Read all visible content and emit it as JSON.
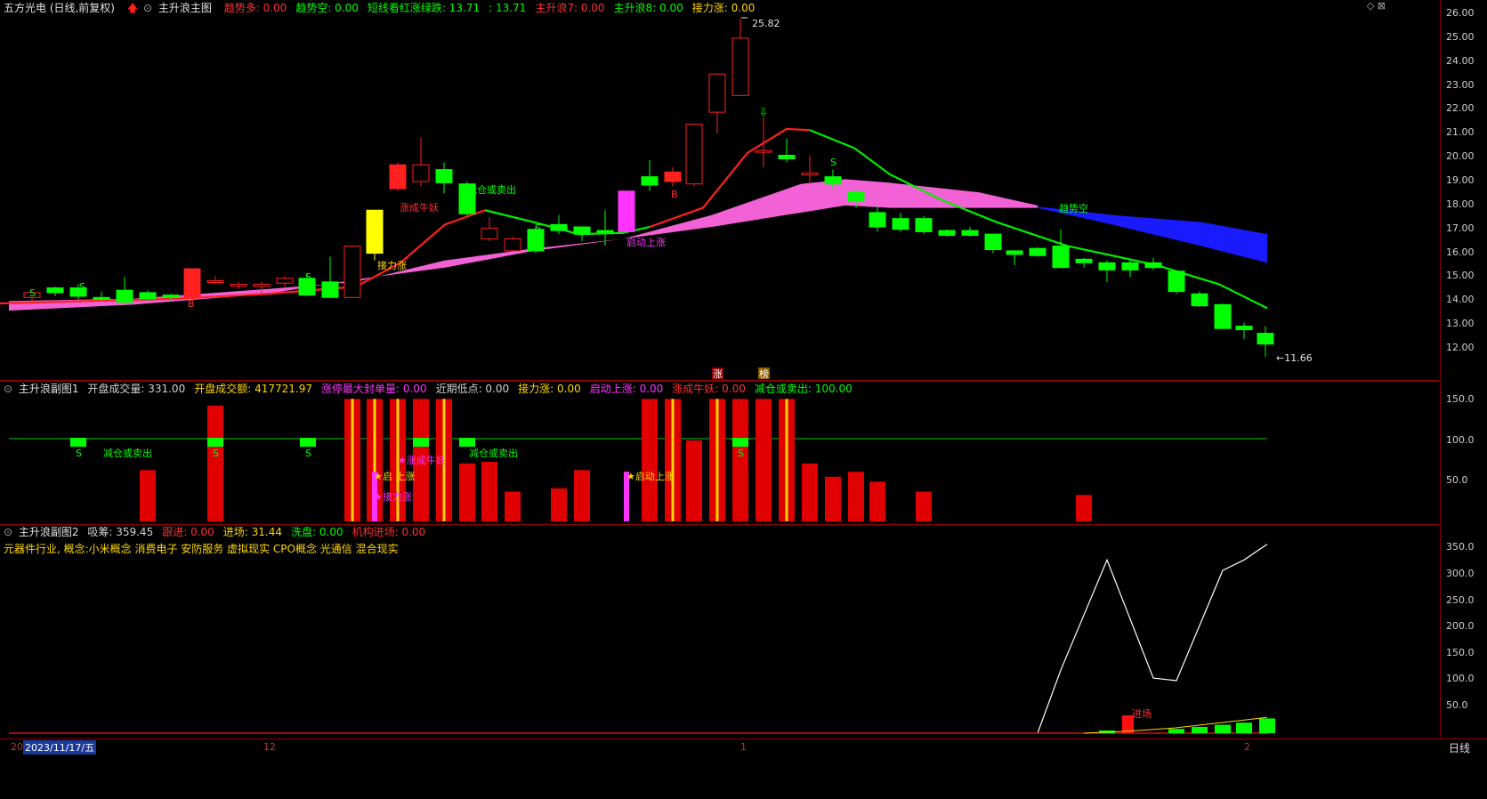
{
  "main": {
    "stock": "五方光电 (日线,前复权)",
    "indicator": "主升浪主图",
    "fields": [
      {
        "label": "趋势多:",
        "value": "0.00",
        "color": "#ff3030"
      },
      {
        "label": "趋势空:",
        "value": "0.00",
        "color": "#00ff00"
      },
      {
        "label": "短线看红涨绿跌:",
        "value": "13.71",
        "color": "#00ff00"
      },
      {
        "label": ":",
        "value": "13.71",
        "color": "#00ff00"
      },
      {
        "label": "主升浪7:",
        "value": "0.00",
        "color": "#ff3030"
      },
      {
        "label": "主升浪8:",
        "value": "0.00",
        "color": "#00ff00"
      },
      {
        "label": "接力涨:",
        "value": "0.00",
        "color": "#ffd700"
      }
    ],
    "high_label": "25.82",
    "low_label": "11.66",
    "annotations": {
      "zhangcheng": "涨成牛妖",
      "jianCang1": "减仓或卖出",
      "qidong": "启动上涨",
      "jieli": "接力涨",
      "qushi_kong": "趋势空",
      "s": "S",
      "b": "B"
    },
    "yticks": [
      "26.00",
      "25.00",
      "24.00",
      "23.00",
      "22.00",
      "21.00",
      "20.00",
      "19.00",
      "18.00",
      "17.00",
      "16.00",
      "15.00",
      "14.00",
      "13.00",
      "12.00"
    ],
    "markers": [
      "涨",
      "榜"
    ]
  },
  "sub1": {
    "title": "主升浪副图1",
    "fields": [
      {
        "label": "开盘成交量:",
        "value": "331.00",
        "color": "#d0d0d0"
      },
      {
        "label": "开盘成交额:",
        "value": "417721.97",
        "color": "#ffd700"
      },
      {
        "label": "涨停最大封单量:",
        "value": "0.00",
        "color": "#ff33ff"
      },
      {
        "label": "近期低点:",
        "value": "0.00",
        "color": "#d0d0d0"
      },
      {
        "label": "接力涨:",
        "value": "0.00",
        "color": "#ffd700"
      },
      {
        "label": "启动上涨:",
        "value": "0.00",
        "color": "#ff33ff"
      },
      {
        "label": "涨成牛妖:",
        "value": "0.00",
        "color": "#ff3030"
      },
      {
        "label": "减仓或卖出:",
        "value": "100.00",
        "color": "#00ff00"
      }
    ],
    "yticks": [
      "150.0",
      "100.0",
      "50.0"
    ],
    "labels": {
      "jc": "减仓或卖出",
      "qd": "★启动上涨",
      "zc": "★涨成牛妖",
      "jl": "★接力涨",
      "qd2": "★启  上涨"
    }
  },
  "sub2": {
    "title": "主升浪副图2",
    "fields": [
      {
        "label": "吸筹:",
        "value": "359.45",
        "color": "#d0d0d0"
      },
      {
        "label": "跟进:",
        "value": "0.00",
        "color": "#ff3030"
      },
      {
        "label": "进场:",
        "value": "31.44",
        "color": "#ffd700"
      },
      {
        "label": "洗盘:",
        "value": "0.00",
        "color": "#00ff00"
      },
      {
        "label": "机构进场:",
        "value": "0.00",
        "color": "#ff3030"
      }
    ],
    "concept": "元器件行业,  概念:小米概念 消费电子 安防服务 虚拟现实 CPO概念 光通信 混合现实",
    "yticks": [
      "350.0",
      "300.0",
      "250.0",
      "200.0",
      "150.0",
      "100.0",
      "50.0"
    ],
    "entry_label": "进场"
  },
  "timeline": {
    "start": "20",
    "date": "2023/11/17/五",
    "m12": "12",
    "m1": "1",
    "m2": "2",
    "period": "日线"
  },
  "colors": {
    "up": "#ff2020",
    "down": "#00ff00",
    "band": "#ff66e0",
    "blue": "#1a1aff",
    "ma_red": "#ff2020",
    "ma_green": "#00ee00"
  }
}
